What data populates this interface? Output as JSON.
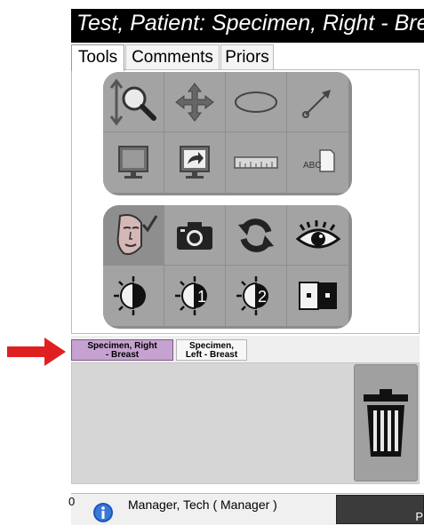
{
  "window": {
    "title": "Test, Patient:  Specimen, Right - Breast"
  },
  "tabs": [
    {
      "label": "Tools",
      "active": true
    },
    {
      "label": "Comments",
      "active": false
    },
    {
      "label": "Priors",
      "active": false
    }
  ],
  "tools_top": [
    [
      "zoom-magnify",
      "pan",
      "ellipse",
      "arrow"
    ],
    [
      "monitor",
      "share-to-monitor",
      "ruler",
      "text-label"
    ]
  ],
  "tools_bottom": [
    [
      "face-check",
      "camera",
      "refresh",
      "eye"
    ],
    [
      "contrast",
      "contrast-1",
      "contrast-2",
      "split-view"
    ]
  ],
  "specimen_tabs": [
    {
      "label_line1": "Specimen, Right",
      "label_line2": "- Breast",
      "selected": true
    },
    {
      "label_line1": "Specimen,",
      "label_line2": "Left - Breast",
      "selected": false
    }
  ],
  "status_bar": {
    "left_text": "0",
    "user": "Manager, Tech ( Manager )",
    "right_fragment": "P"
  },
  "colors": {
    "selected_tab": "#c6a2d0",
    "arrow": "#e02020",
    "info": "#1a56b8"
  }
}
